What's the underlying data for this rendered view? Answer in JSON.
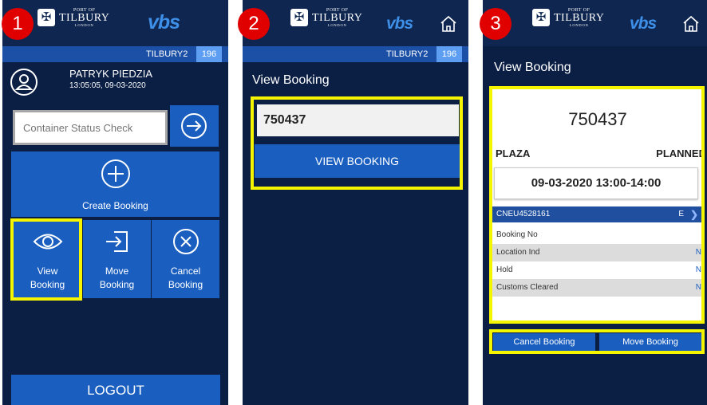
{
  "brand": {
    "logo_line1": "PORT OF",
    "logo_line2": "TILBURY",
    "logo_line3": "LONDON",
    "app_logo": "vbs",
    "accent_color": "#1a5fc0",
    "background_color": "#0b1f45",
    "highlight_color": "#f5f500",
    "step_badge_color": "#e00000"
  },
  "steps": {
    "step1": "1",
    "step2": "2",
    "step3": "3"
  },
  "status": {
    "terminal": "TILBURY2",
    "count": "196"
  },
  "screen1": {
    "user_name": "PATRYK PIEDZIA",
    "user_datetime": "13:05:05, 09-03-2020",
    "status_check_placeholder": "Container Status Check",
    "create_booking_label": "Create Booking",
    "view_booking_line1": "View",
    "view_booking_line2": "Booking",
    "move_booking_line1": "Move",
    "move_booking_line2": "Booking",
    "cancel_booking_line1": "Cancel",
    "cancel_booking_line2": "Booking",
    "logout_label": "LOGOUT",
    "icons": [
      "user-icon",
      "arrow-right-circle-icon",
      "plus-circle-icon",
      "eye-icon",
      "enter-box-icon",
      "x-circle-icon"
    ]
  },
  "screen2": {
    "title": "View Booking",
    "booking_input_value": "750437",
    "view_booking_button": "VIEW BOOKING",
    "icons": [
      "home-icon"
    ]
  },
  "screen3": {
    "title": "View Booking",
    "booking_number": "750437",
    "location": "PLAZA",
    "booking_status": "PLANNED",
    "time_slot": "09-03-2020 13:00-14:00",
    "container": {
      "number": "CNEU4528161",
      "type": "E"
    },
    "details": [
      {
        "label": "Booking No",
        "value": ""
      },
      {
        "label": "Location Ind",
        "value": "N"
      },
      {
        "label": "Hold",
        "value": "N"
      },
      {
        "label": "Customs Cleared",
        "value": "N"
      }
    ],
    "cancel_booking_button": "Cancel Booking",
    "move_booking_button": "Move Booking",
    "icons": [
      "home-icon",
      "chevron-right-icon"
    ]
  }
}
